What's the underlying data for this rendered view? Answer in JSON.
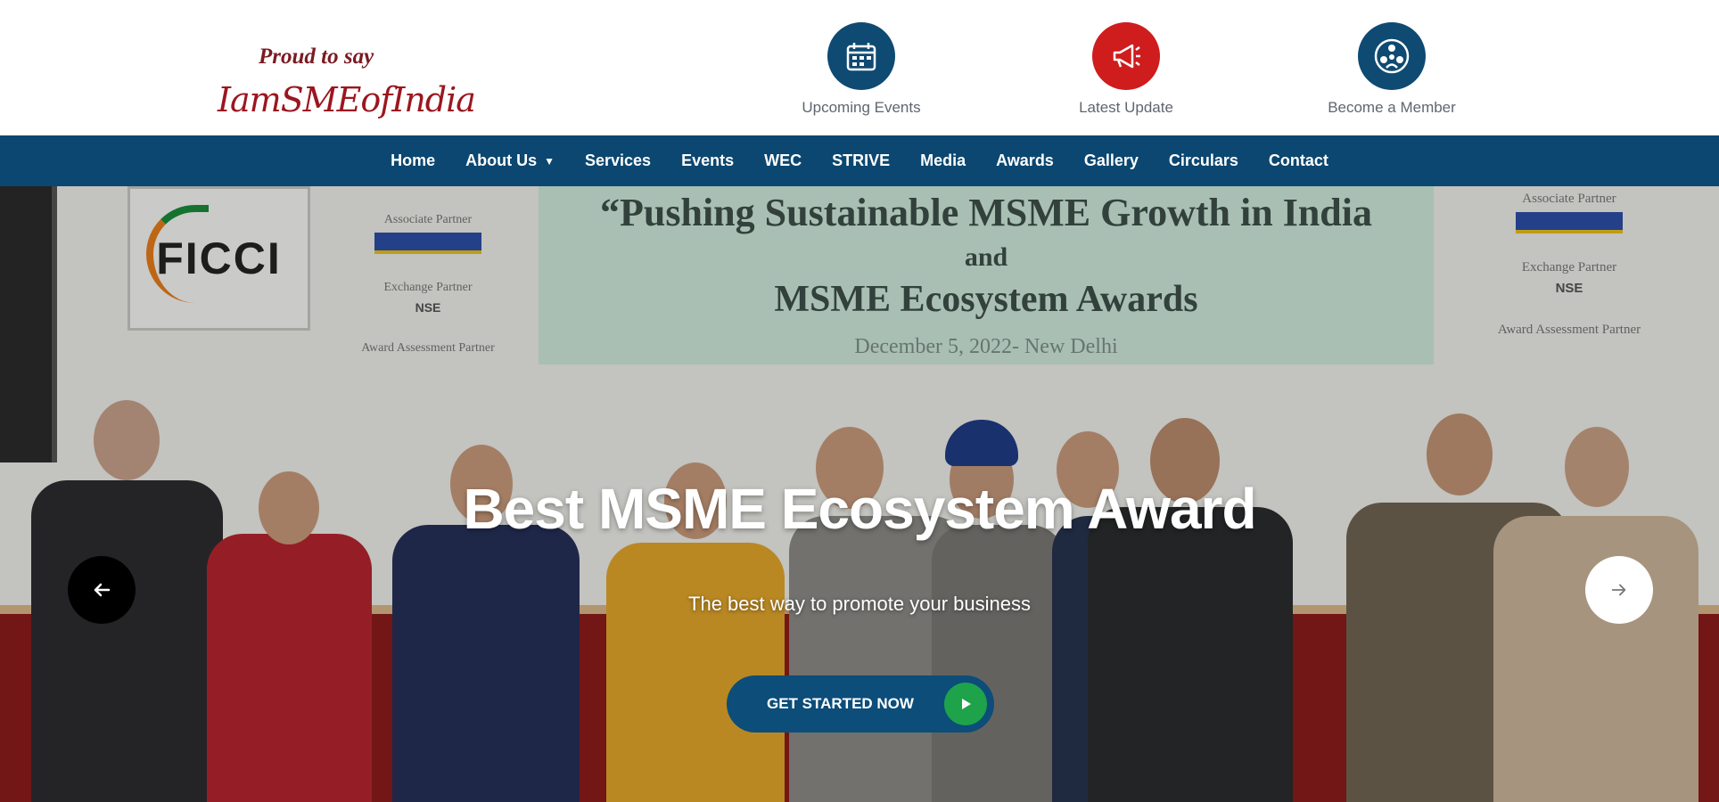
{
  "logo": {
    "tagline": "Proud to say",
    "brand": "IamSMEofIndia"
  },
  "quick_links": [
    {
      "label": "Upcoming Events",
      "icon": "calendar-icon",
      "color": "#0e4a72"
    },
    {
      "label": "Latest Update",
      "icon": "megaphone-icon",
      "color": "#cf1c1c"
    },
    {
      "label": "Become a Member",
      "icon": "members-icon",
      "color": "#0e4a72"
    }
  ],
  "nav": {
    "items": [
      "Home",
      "About Us",
      "Services",
      "Events",
      "WEC",
      "STRIVE",
      "Media",
      "Awards",
      "Gallery",
      "Circulars",
      "Contact"
    ],
    "dropdown_icon": "chevron-down-icon",
    "background": "#0b4770"
  },
  "hero": {
    "banner": {
      "line1": "“Pushing Sustainable MSME Growth in India",
      "line2": "and",
      "line3": "MSME Ecosystem Awards",
      "line4": "December 5, 2022- New Delhi"
    },
    "board_text": "FICCI",
    "partners_left": [
      "Associate Partner",
      "Exchange Partner",
      "NSE",
      "Award Assessment Partner"
    ],
    "partners_right": [
      "Associate Partner",
      "Exchange Partner",
      "NSE",
      "Award Assessment Partner"
    ],
    "title": "Best MSME Ecosystem Award",
    "subtitle": "The best way to promote your business",
    "cta_label": "GET STARTED NOW",
    "prev_icon": "arrow-left-icon",
    "next_icon": "arrow-right-icon"
  }
}
